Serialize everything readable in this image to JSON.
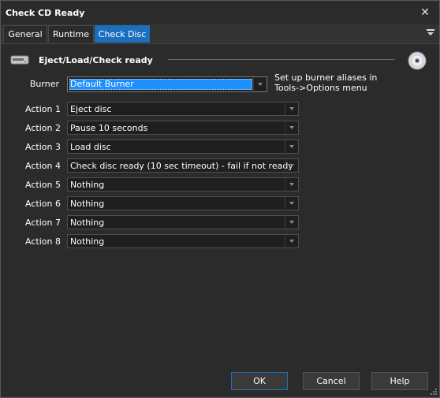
{
  "window": {
    "title": "Check CD Ready",
    "close_symbol": "✕"
  },
  "tabs": [
    {
      "label": "General",
      "active": false
    },
    {
      "label": "Runtime",
      "active": false
    },
    {
      "label": "Check Disc",
      "active": true
    }
  ],
  "tab_menu_icon": "hamburger-icon",
  "section": {
    "title": "Eject/Load/Check ready",
    "icon": "drive-icon",
    "right_icon": "disc-icon"
  },
  "burner": {
    "label": "Burner",
    "value": "Default Burner",
    "hint": "Set up burner aliases in Tools->Options menu"
  },
  "actions": [
    {
      "label": "Action 1",
      "value": "Eject disc"
    },
    {
      "label": "Action 2",
      "value": "Pause 10 seconds"
    },
    {
      "label": "Action 3",
      "value": "Load disc"
    },
    {
      "label": "Action 4",
      "value": "Check disc ready (10 sec timeout) - fail if not ready"
    },
    {
      "label": "Action 5",
      "value": "Nothing"
    },
    {
      "label": "Action 6",
      "value": "Nothing"
    },
    {
      "label": "Action 7",
      "value": "Nothing"
    },
    {
      "label": "Action 8",
      "value": "Nothing"
    }
  ],
  "buttons": {
    "ok": "OK",
    "cancel": "Cancel",
    "help": "Help"
  },
  "colors": {
    "accent": "#1c6fbf",
    "selection": "#1e8fff",
    "background": "#2b2b2b"
  }
}
